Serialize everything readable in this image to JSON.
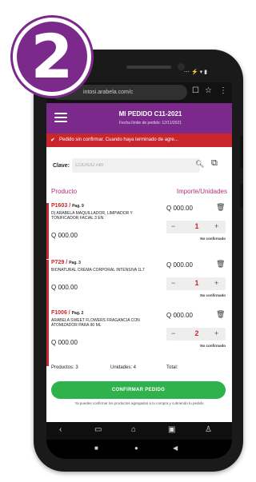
{
  "badge": {
    "number": "2"
  },
  "status_bar": {
    "icons": "⋯ ⚡ ▾ ▮"
  },
  "browser": {
    "url": "intosi.arabela.com/c",
    "tabs_icon": "tabs-icon",
    "star_icon": "star-icon",
    "menu_icon": "more-icon"
  },
  "header": {
    "title": "MI PEDIDO C11-2021",
    "subtitle": "Fecha límite de pedido: 12/11/2021"
  },
  "alert": {
    "text": "Pedido sin confirmar. Cuando haya terminado de agre..."
  },
  "search": {
    "label": "Clave:",
    "placeholder": "CÓDIGO ABI"
  },
  "columns": {
    "product": "Producto",
    "amount": "Importe/Unidades"
  },
  "items": [
    {
      "code": "P1603",
      "page": "Pag. 9",
      "name": "D) ARABELA MAQUILLADOR, LIMPIADOR Y TONIFICADOR FACIAL 3 EN",
      "unit_price": "Q 000.00",
      "amount": "Q 000.00",
      "minus": "−",
      "qty": "1",
      "plus": "+",
      "status": "No confirmado"
    },
    {
      "code": "P729",
      "page": "Pag. 3",
      "name": "BIONATURAL CREMA CORPORAL INTENSIVA 1L7",
      "unit_price": "Q 000.00",
      "amount": "Q 000.00",
      "minus": "−",
      "qty": "1",
      "plus": "+",
      "status": "No confirmado"
    },
    {
      "code": "F1006",
      "page": "Pag. 2",
      "name": "ARABELA SWEET FLOWERS FRAGANCIA CON ATOMIZADOR PARA 90 ML",
      "unit_price": "Q 000.00",
      "amount": "Q 000.00",
      "minus": "−",
      "qty": "2",
      "plus": "+",
      "status": "No confirmado"
    }
  ],
  "totals": {
    "products": "Productos: 3",
    "units": "Unidades: 4",
    "total": "Total:"
  },
  "confirm": {
    "label": "CONFIRMAR PEDIDO",
    "note": "Ya puedes confirmar los productos agregados a tu compra y cubriendo tu pedido"
  },
  "nav": {
    "icons": [
      "back-icon",
      "book-icon",
      "home-icon",
      "cart-icon",
      "profile-icon"
    ]
  },
  "system_nav": {
    "icons": [
      "recent-apps-icon",
      "home-circle-icon",
      "back-triangle-icon"
    ]
  },
  "colors": {
    "brand_purple": "#7b2a8c",
    "alert_red": "#c7262c",
    "accent_pink": "#b0307a",
    "confirm_green": "#2fb24c"
  }
}
